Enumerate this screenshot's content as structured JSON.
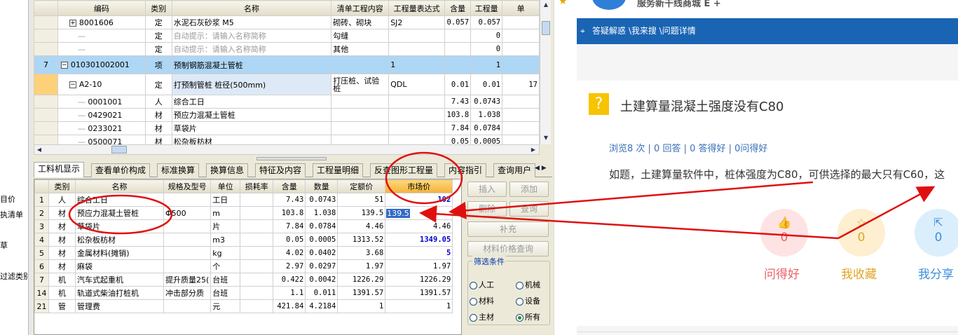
{
  "left_strip": {
    "items": [
      "目价",
      "执清单",
      "草",
      "过滤类别"
    ]
  },
  "grid1": {
    "headers": [
      "编码",
      "类别",
      "名称",
      "清单工程内容",
      "工程量表达式",
      "含量",
      "工程量",
      "单"
    ],
    "rows": [
      {
        "no": "",
        "code": "8001606",
        "expander": "+",
        "type": "定",
        "name": "水泥石灰砂浆 M5",
        "content": "砌砖、砌块",
        "expr": "SJ2",
        "qty": "0.057",
        "amount": "0.057",
        "price": ""
      },
      {
        "no": "",
        "code": "",
        "expander": "",
        "type": "定",
        "name": "自动提示：请输入名称简称",
        "content": "勾缝",
        "expr": "",
        "qty": "",
        "amount": "0",
        "price": ""
      },
      {
        "no": "",
        "code": "",
        "expander": "",
        "type": "定",
        "name": "自动提示：请输入名称简称",
        "content": "其他",
        "expr": "",
        "qty": "",
        "amount": "0",
        "price": ""
      },
      {
        "no": "7",
        "code": "010301002001",
        "expander": "−",
        "type": "项",
        "name": "预制钢筋混凝土管桩",
        "content": "",
        "expr": "1",
        "qty": "",
        "amount": "1",
        "price": ""
      },
      {
        "no": "",
        "code": "A2-10",
        "expander": "−",
        "type": "定",
        "name": "打预制管桩 桩径(500mm)",
        "content": "打压桩、试验桩",
        "expr": "QDL",
        "qty": "0.01",
        "amount": "0.01",
        "price": "17"
      },
      {
        "no": "",
        "code": "0001001",
        "expander": "",
        "type": "人",
        "name": "综合工日",
        "content": "",
        "expr": "",
        "qty": "7.43",
        "amount": "0.0743",
        "price": ""
      },
      {
        "no": "",
        "code": "0429021",
        "expander": "",
        "type": "材",
        "name": "预应力混凝土管桩",
        "content": "",
        "expr": "",
        "qty": "103.8",
        "amount": "1.038",
        "price": ""
      },
      {
        "no": "",
        "code": "0233021",
        "expander": "",
        "type": "材",
        "name": "草袋片",
        "content": "",
        "expr": "",
        "qty": "7.84",
        "amount": "0.0784",
        "price": ""
      },
      {
        "no": "",
        "code": "0500071",
        "expander": "",
        "type": "材",
        "name": "松杂板枋材",
        "content": "",
        "expr": "",
        "qty": "0.05",
        "amount": "0.0005",
        "price": ""
      }
    ]
  },
  "tabs": [
    "工料机显示",
    "查看单价构成",
    "标准换算",
    "换算信息",
    "特征及内容",
    "工程量明细",
    "反查图形工程量",
    "内容指引",
    "查询用户"
  ],
  "grid2": {
    "headers": [
      "",
      "类别",
      "名称",
      "规格及型号",
      "单位",
      "损耗率",
      "含量",
      "数量",
      "定额价",
      "市场价"
    ],
    "rows": [
      {
        "no": "1",
        "type": "人",
        "name": "综合工日",
        "spec": "",
        "unit": "工日",
        "loss": "",
        "qty": "7.43",
        "count": "0.0743",
        "base": "51",
        "market": "102",
        "market_style": "blue"
      },
      {
        "no": "2",
        "type": "材",
        "name": "预应力混凝土管桩",
        "spec": "Φ500",
        "unit": "m",
        "loss": "",
        "qty": "103.8",
        "count": "1.038",
        "base": "139.5",
        "market": "139.5",
        "market_style": "editing"
      },
      {
        "no": "3",
        "type": "材",
        "name": "草袋片",
        "spec": "",
        "unit": "片",
        "loss": "",
        "qty": "7.84",
        "count": "0.0784",
        "base": "4.46",
        "market": "4.46",
        "market_style": ""
      },
      {
        "no": "4",
        "type": "材",
        "name": "松杂板枋材",
        "spec": "",
        "unit": "m3",
        "loss": "",
        "qty": "0.05",
        "count": "0.0005",
        "base": "1313.52",
        "market": "1349.05",
        "market_style": "blue"
      },
      {
        "no": "5",
        "type": "材",
        "name": "金属材料(摊销)",
        "spec": "",
        "unit": "kg",
        "loss": "",
        "qty": "4.02",
        "count": "0.0402",
        "base": "3.68",
        "market": "5",
        "market_style": "blue"
      },
      {
        "no": "6",
        "type": "材",
        "name": "麻袋",
        "spec": "",
        "unit": "个",
        "loss": "",
        "qty": "2.97",
        "count": "0.0297",
        "base": "1.97",
        "market": "1.97",
        "market_style": ""
      },
      {
        "no": "7",
        "type": "机",
        "name": "汽车式起重机",
        "spec": "提升质量25(",
        "unit": "台班",
        "loss": "",
        "qty": "0.422",
        "count": "0.0042",
        "base": "1226.29",
        "market": "1226.29",
        "market_style": ""
      },
      {
        "no": "14",
        "type": "机",
        "name": "轨道式柴油打桩机",
        "spec": "冲击部分质",
        "unit": "台班",
        "loss": "",
        "qty": "1.1",
        "count": "0.011",
        "base": "1391.57",
        "market": "1391.57",
        "market_style": ""
      },
      {
        "no": "21",
        "type": "管",
        "name": "管理费",
        "spec": "",
        "unit": "元",
        "loss": "",
        "qty": "421.84",
        "count": "4.2184",
        "base": "1",
        "market": "1",
        "market_style": ""
      }
    ]
  },
  "side": {
    "buttons": {
      "insert": "插入",
      "add": "添加",
      "delete": "删除",
      "query": "查询",
      "supplement": "补充",
      "price_query": "材料价格查询"
    },
    "filter_title": "筛选条件",
    "options": [
      {
        "label": "人工",
        "checked": false
      },
      {
        "label": "机械",
        "checked": false
      },
      {
        "label": "材料",
        "checked": false
      },
      {
        "label": "设备",
        "checked": false
      },
      {
        "label": "主材",
        "checked": false
      },
      {
        "label": "所有",
        "checked": true
      }
    ]
  },
  "web": {
    "slogan": "服务新干线商城 E +",
    "breadcrumb": "答疑解惑 \\我来搜 \\问题详情",
    "question_title": "土建算量混凝土强度没有C80",
    "stats": "浏览8 次 | 0 回答 | 0 答得好 | 0问得好",
    "body": "如题，土建算量软件中，桩体强度为C80，可供选择的最大只有C60，这",
    "actions": [
      {
        "label": "问得好",
        "count": "0",
        "icon": "thumb-up-icon",
        "color": "#e8646a",
        "bg": "#fde3e4"
      },
      {
        "label": "我收藏",
        "count": "0",
        "icon": "star-icon",
        "color": "#e0a52a",
        "bg": "#fdefcf"
      },
      {
        "label": "我分享",
        "count": "0",
        "icon": "share-icon",
        "color": "#3e8fdc",
        "bg": "#dbeefb"
      }
    ]
  },
  "colors": {
    "annotation": "#e01010",
    "breadcrumb_bg": "#1a64b4",
    "selected_row": "#aed6f5",
    "market_header": "#f3b13c"
  }
}
